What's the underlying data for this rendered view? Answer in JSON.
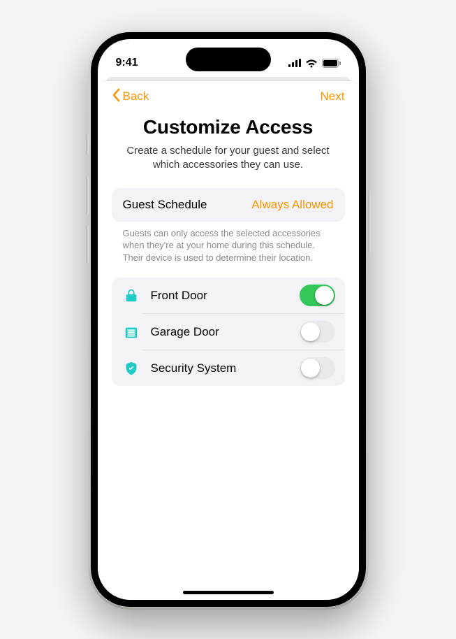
{
  "status": {
    "time": "9:41"
  },
  "nav": {
    "back_label": "Back",
    "next_label": "Next"
  },
  "header": {
    "title": "Customize Access",
    "subtitle": "Create a schedule for your guest and select which accessories they can use."
  },
  "schedule": {
    "label": "Guest Schedule",
    "value": "Always Allowed",
    "footnote": "Guests can only access the selected accessories when they're at your home during this schedule. Their device is used to determine their location."
  },
  "accessories": [
    {
      "icon": "lock",
      "label": "Front Door",
      "on": true
    },
    {
      "icon": "garage",
      "label": "Garage Door",
      "on": false
    },
    {
      "icon": "shield",
      "label": "Security System",
      "on": false
    }
  ],
  "colors": {
    "accent": "#ff9500",
    "teal": "#1ecbc7",
    "toggle_on": "#34c759"
  }
}
